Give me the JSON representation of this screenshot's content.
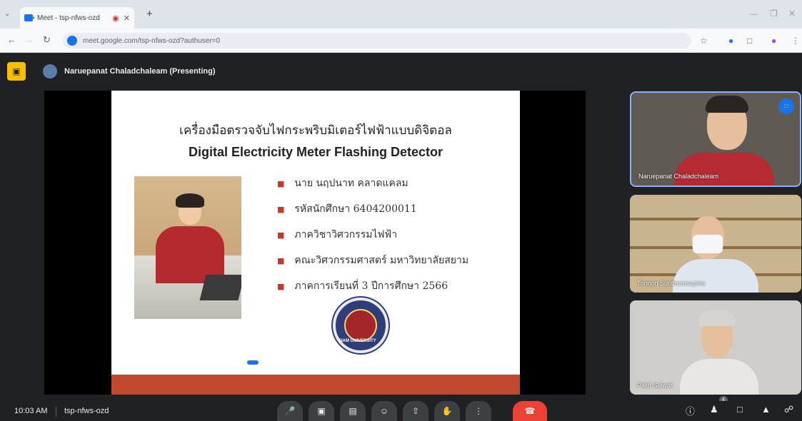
{
  "browser": {
    "tab_title": "Meet - tsp-nfws-ozd",
    "new_tab_symbol": "+",
    "url": "meet.google.com/tsp-nfws-ozd?authuser=0"
  },
  "meet": {
    "presenter_label": "Naruepanat Chaladchaleam (Presenting)",
    "meeting_time": "10:03 AM",
    "meeting_code": "tsp-nfws-ozd",
    "participant_badge": "4"
  },
  "slide": {
    "title_th": "เครื่องมือตรวจจับไฟกระพริบมิเตอร์ไฟฟ้าแบบดิจิตอล",
    "title_en": "Digital Electricity Meter Flashing Detector",
    "bullets": [
      "นาย นฤปนาท คลาดแคลม",
      "รหัสนักศึกษา 6404200011",
      "ภาควิชาวิศวกรรมไฟฟ้า",
      "คณะวิศวกรรมศาสตร์ มหาวิทยาลัยสยาม",
      "ภาคการเรียนที่ 3 ปีการศึกษา 2566"
    ],
    "seal_text": "SIAM UNIVERSITY"
  },
  "participants": [
    {
      "name": "Naruepanat Chaladchaleam",
      "speaking": true
    },
    {
      "name": "Tonnon Sunthornsophia",
      "speaking": false
    },
    {
      "name": "Pakit Saiwat",
      "speaking": false
    }
  ],
  "colors": {
    "accent": "#1a73e8",
    "hangup": "#ea4335",
    "presenting": "#fbbc04",
    "slide_band": "#c0482e"
  }
}
